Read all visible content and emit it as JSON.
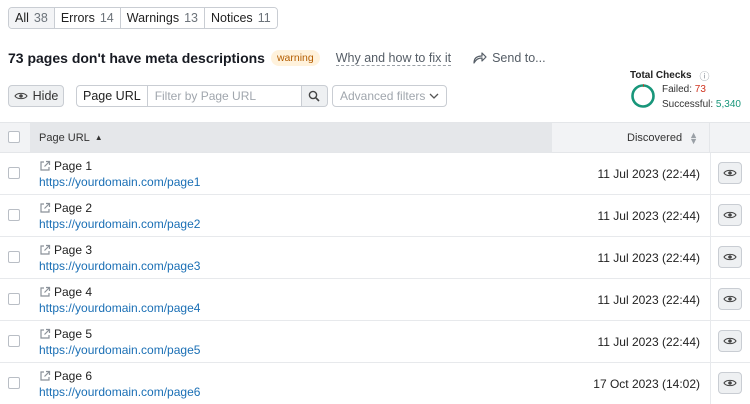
{
  "tabs": [
    {
      "label": "All",
      "count": "38"
    },
    {
      "label": "Errors",
      "count": "14"
    },
    {
      "label": "Warnings",
      "count": "13"
    },
    {
      "label": "Notices",
      "count": "11"
    }
  ],
  "issue": {
    "title": "73 pages don't have meta descriptions",
    "badge": "warning",
    "fix_link": "Why and how to fix it",
    "send_label": "Send to..."
  },
  "toolbar": {
    "hide_label": "Hide",
    "url_filter_label": "Page URL",
    "url_filter_placeholder": "Filter by Page URL",
    "advanced_filters": "Advanced filters"
  },
  "totals": {
    "label": "Total Checks",
    "failed_label": "Failed:",
    "failed_value": "73",
    "success_label": "Successful:",
    "success_value": "5,340",
    "colors": {
      "failed": "#d0331f",
      "success": "#18967a"
    }
  },
  "table": {
    "columns": {
      "url": "Page URL",
      "discovered": "Discovered"
    },
    "rows": [
      {
        "title": "Page 1",
        "url": "https://yourdomain.com/page1",
        "discovered": "11 Jul 2023 (22:44)"
      },
      {
        "title": "Page 2",
        "url": "https://yourdomain.com/page2",
        "discovered": "11 Jul 2023 (22:44)"
      },
      {
        "title": "Page 3",
        "url": "https://yourdomain.com/page3",
        "discovered": "11 Jul 2023 (22:44)"
      },
      {
        "title": "Page 4",
        "url": "https://yourdomain.com/page4",
        "discovered": "11 Jul 2023 (22:44)"
      },
      {
        "title": "Page 5",
        "url": "https://yourdomain.com/page5",
        "discovered": "11 Jul 2023 (22:44)"
      },
      {
        "title": "Page 6",
        "url": "https://yourdomain.com/page6",
        "discovered": "17 Oct 2023 (14:02)"
      }
    ]
  },
  "icons": {
    "hide": "eye-icon",
    "search": "search-icon",
    "advanced": "chevron-down-icon",
    "send": "share-arrow-icon",
    "row_link": "external-link-icon",
    "row_action": "eye-icon",
    "sort": "sort-icon",
    "info": "info-icon"
  }
}
